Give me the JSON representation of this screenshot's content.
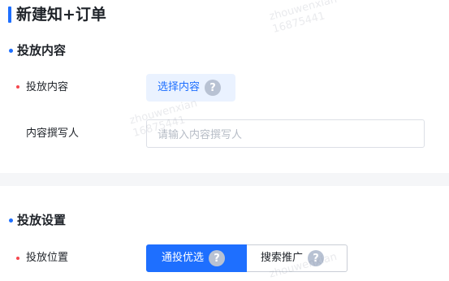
{
  "page": {
    "title": "新建知+订单"
  },
  "sections": {
    "placement_content": {
      "title": "投放内容",
      "content_field": {
        "label": "投放内容",
        "button_label": "选择内容"
      },
      "writer_field": {
        "label": "内容撰写人",
        "placeholder": "请输入内容撰写人"
      }
    },
    "placement_settings": {
      "title": "投放设置",
      "position_field": {
        "label": "投放位置",
        "options": [
          {
            "label": "通投优选",
            "selected": true
          },
          {
            "label": "搜索推广",
            "selected": false
          }
        ]
      }
    }
  },
  "help_glyph": "?",
  "watermark": {
    "name": "zhouwenxian",
    "id": "16875441"
  },
  "colors": {
    "accent": "#1e6fff",
    "required": "#f5474e",
    "help_icon": "#b8c2d3",
    "divider": "#f5f6f8"
  }
}
